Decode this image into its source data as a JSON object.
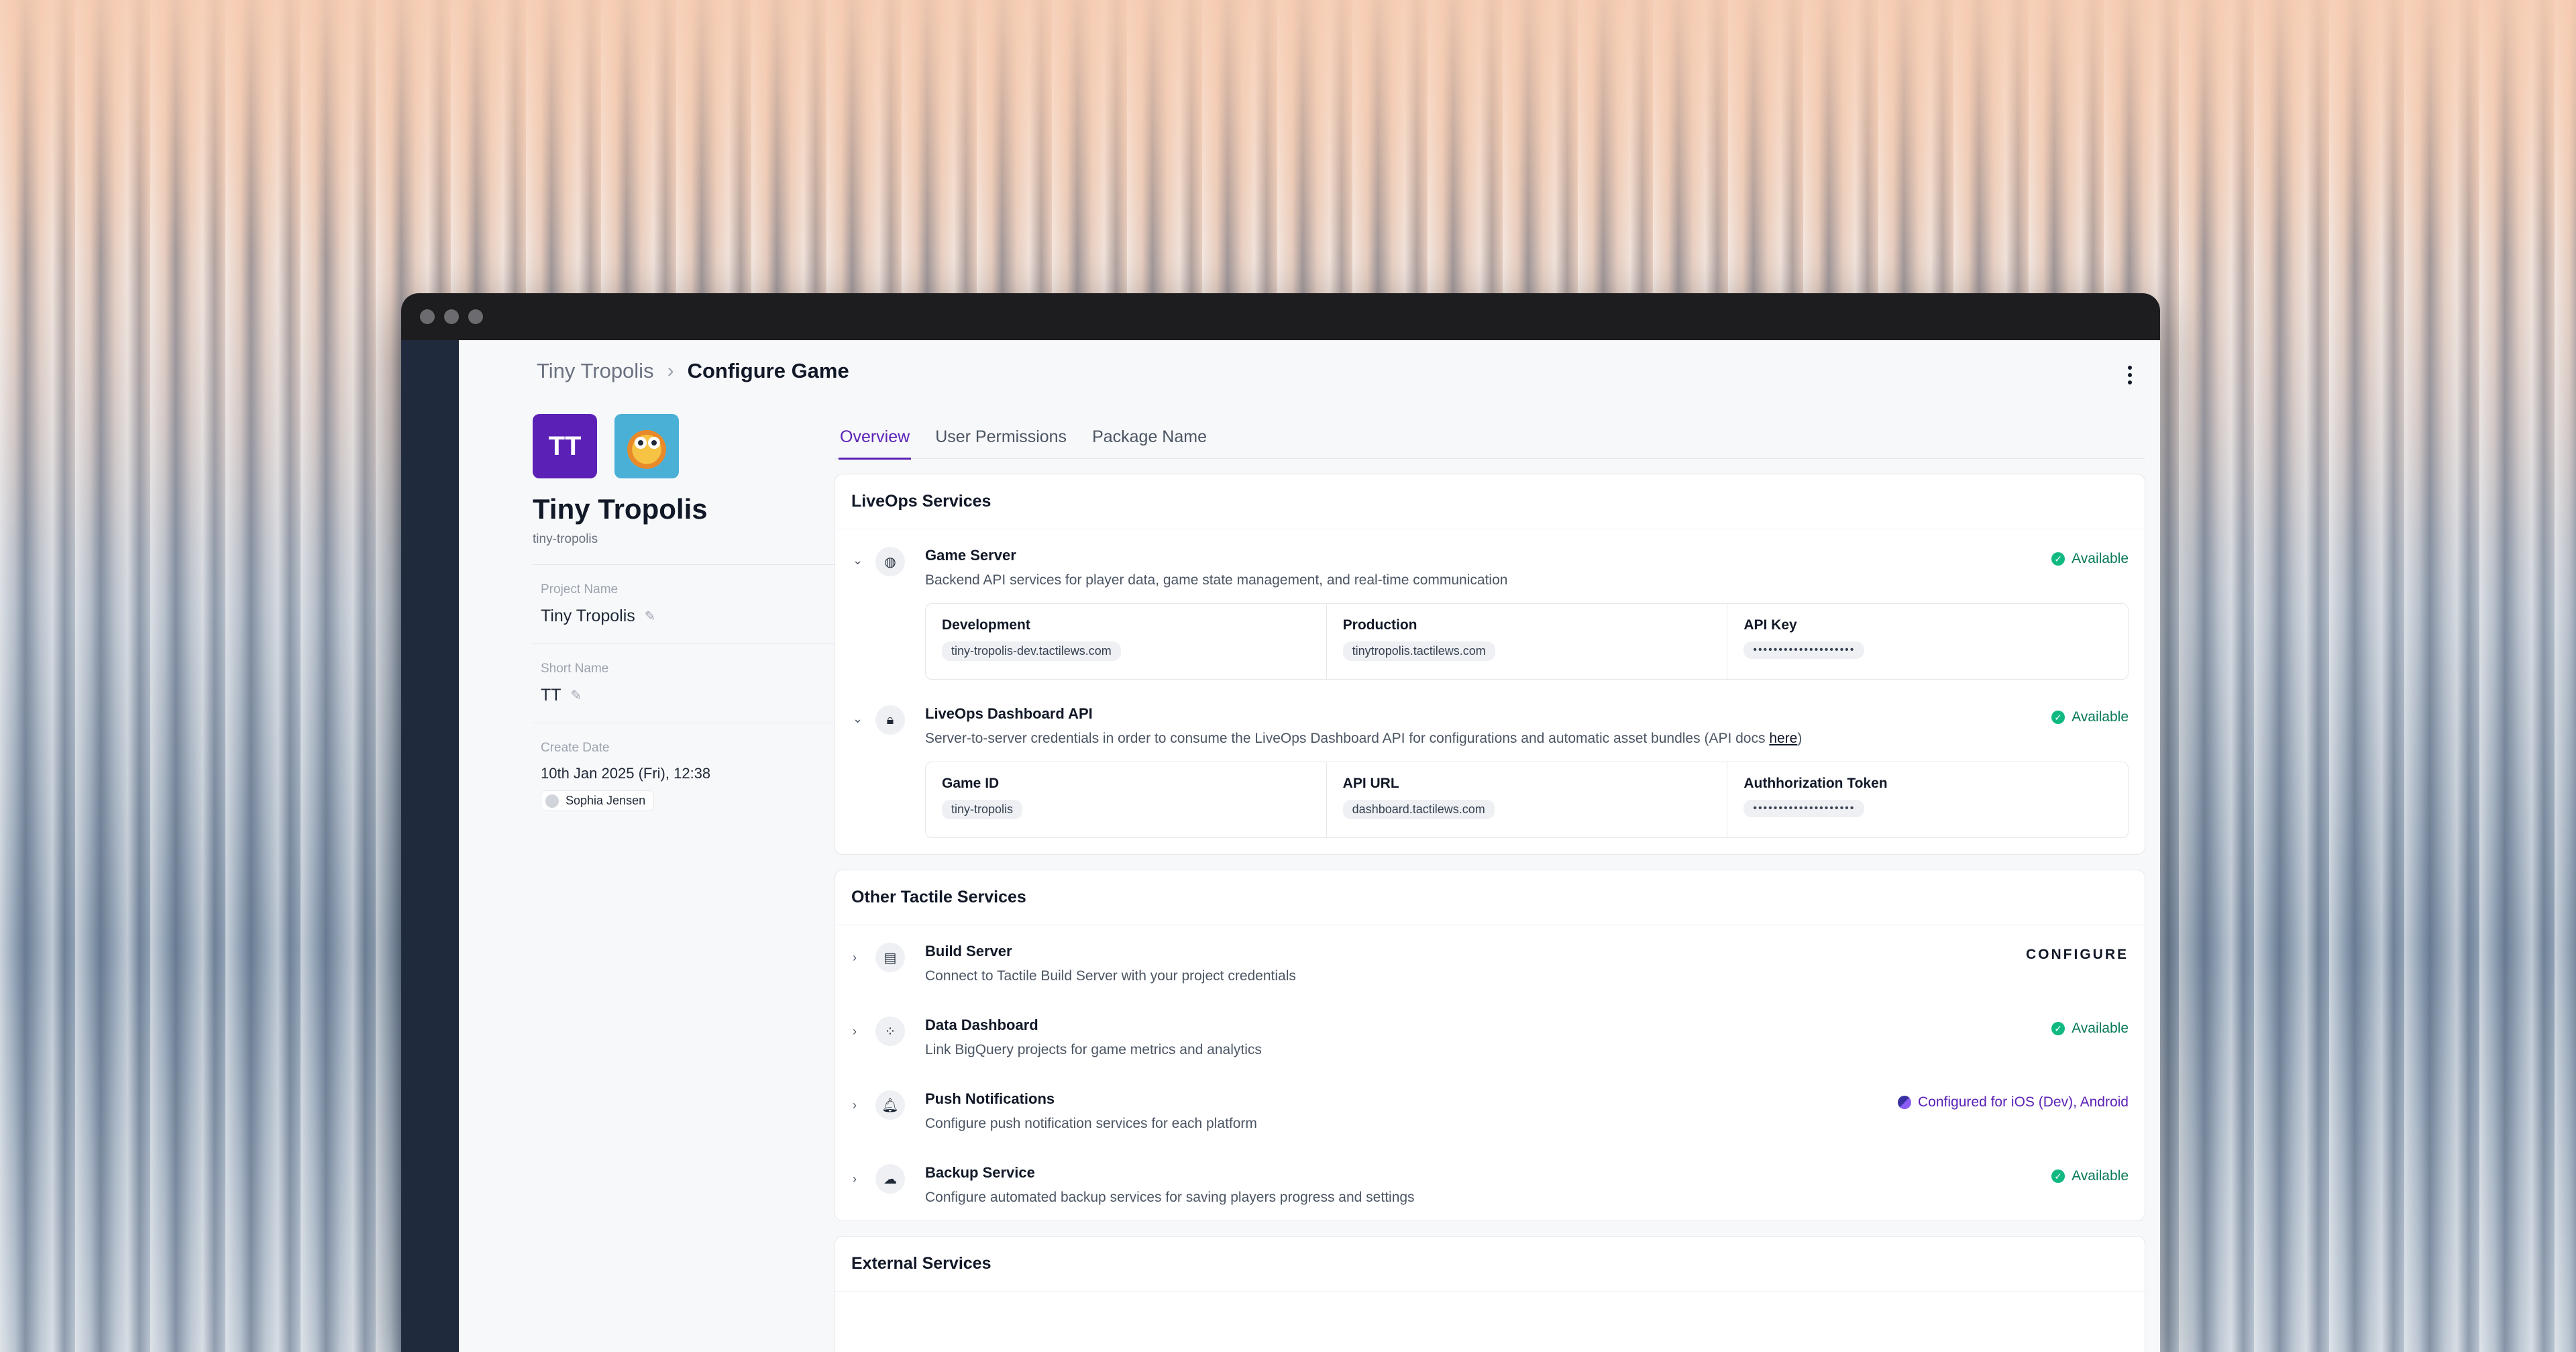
{
  "breadcrumb": {
    "parent": "Tiny Tropolis",
    "separator": "›",
    "current": "Configure Game"
  },
  "project": {
    "initials": "TT",
    "title": "Tiny Tropolis",
    "slug": "tiny-tropolis",
    "fields": {
      "project_name_label": "Project Name",
      "project_name": "Tiny Tropolis",
      "short_name_label": "Short Name",
      "short_name": "TT",
      "create_date_label": "Create Date",
      "create_date": "10th Jan 2025 (Fri), 12:38",
      "creator": "Sophia Jensen"
    }
  },
  "tabs": [
    "Overview",
    "User Permissions",
    "Package Name"
  ],
  "liveops": {
    "title": "LiveOps Services",
    "game_server": {
      "title": "Game Server",
      "desc": "Backend API services for player data, game state management, and real-time communication",
      "status": "Available",
      "dev_label": "Development",
      "dev_value": "tiny-tropolis-dev.tactilews.com",
      "prod_label": "Production",
      "prod_value": "tinytropolis.tactilews.com",
      "key_label": "API Key",
      "key_value": "••••••••••••••••••••"
    },
    "dashboard_api": {
      "title": "LiveOps Dashboard API",
      "desc_pre": "Server-to-server credentials in order to consume the LiveOps Dashboard API for configurations and automatic asset bundles (API docs ",
      "desc_link": "here",
      "desc_post": ")",
      "status": "Available",
      "id_label": "Game ID",
      "id_value": "tiny-tropolis",
      "url_label": "API URL",
      "url_value": "dashboard.tactilews.com",
      "token_label": "Authhorization Token",
      "token_value": "••••••••••••••••••••"
    }
  },
  "other": {
    "title": "Other Tactile Services",
    "build": {
      "title": "Build Server",
      "desc": "Connect to Tactile Build Server with your project credentials",
      "action": "CONFIGURE"
    },
    "data": {
      "title": "Data Dashboard",
      "desc": "Link BigQuery projects for game metrics and analytics",
      "status": "Available"
    },
    "push": {
      "title": "Push Notifications",
      "desc": "Configure push notification services for each platform",
      "status": "Configured for iOS (Dev), Android"
    },
    "backup": {
      "title": "Backup Service",
      "desc": "Configure automated backup services for saving players progress and settings",
      "status": "Available"
    }
  },
  "external": {
    "title": "External Services"
  },
  "icons": {
    "globe": "globe-icon",
    "lock": "lock-icon",
    "server": "server-icon",
    "chart": "chart-icon",
    "bell": "bell-icon",
    "cloud": "cloud-upload-icon",
    "check": "check-circle-icon",
    "pencil": "pencil-icon",
    "kebab": "more-vertical-icon"
  },
  "colors": {
    "accent": "#5b21b6",
    "success": "#047857",
    "rail": "#1f2a3d"
  }
}
